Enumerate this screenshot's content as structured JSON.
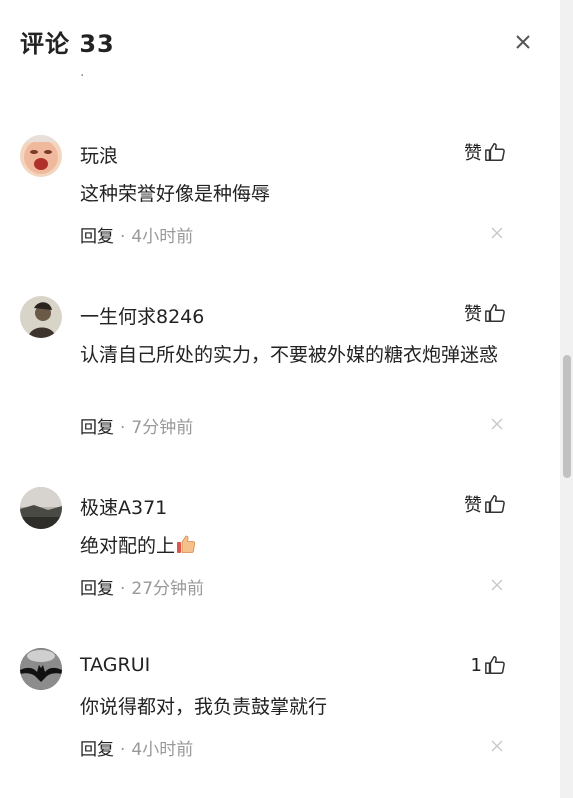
{
  "header": {
    "title_label": "评论",
    "comment_count": "33"
  },
  "comments": [
    {
      "username": "玩浪",
      "text": "这种荣誉好像是种侮辱",
      "like_label": "赞",
      "reply_label": "回复",
      "separator": "·",
      "time": "4小时前",
      "avatar_icon": "crying-baby-avatar"
    },
    {
      "username": "一生何求8246",
      "text": "认清自己所处的实力，不要被外媒的糖衣炮弹迷惑",
      "like_label": "赞",
      "reply_label": "回复",
      "separator": "·",
      "time": "7分钟前",
      "avatar_icon": "portrait-avatar"
    },
    {
      "username": "极速A371",
      "text": "绝对配的上",
      "text_emoji": "thumbs-up-emoji",
      "like_label": "赞",
      "reply_label": "回复",
      "separator": "·",
      "time": "27分钟前",
      "avatar_icon": "landscape-avatar"
    },
    {
      "username": "TAGRUI",
      "text": "你说得都对，我负责鼓掌就行",
      "like_label": "1",
      "reply_label": "回复",
      "separator": "·",
      "time": "4小时前",
      "avatar_icon": "batman-avatar"
    }
  ],
  "colors": {
    "text": "#222222",
    "muted": "#999999",
    "scroll_track": "#f1f1f1",
    "scroll_thumb": "#c1c1c1"
  },
  "icons": {
    "close": "close-icon",
    "like": "thumbs-up-icon",
    "delete": "delete-icon"
  }
}
